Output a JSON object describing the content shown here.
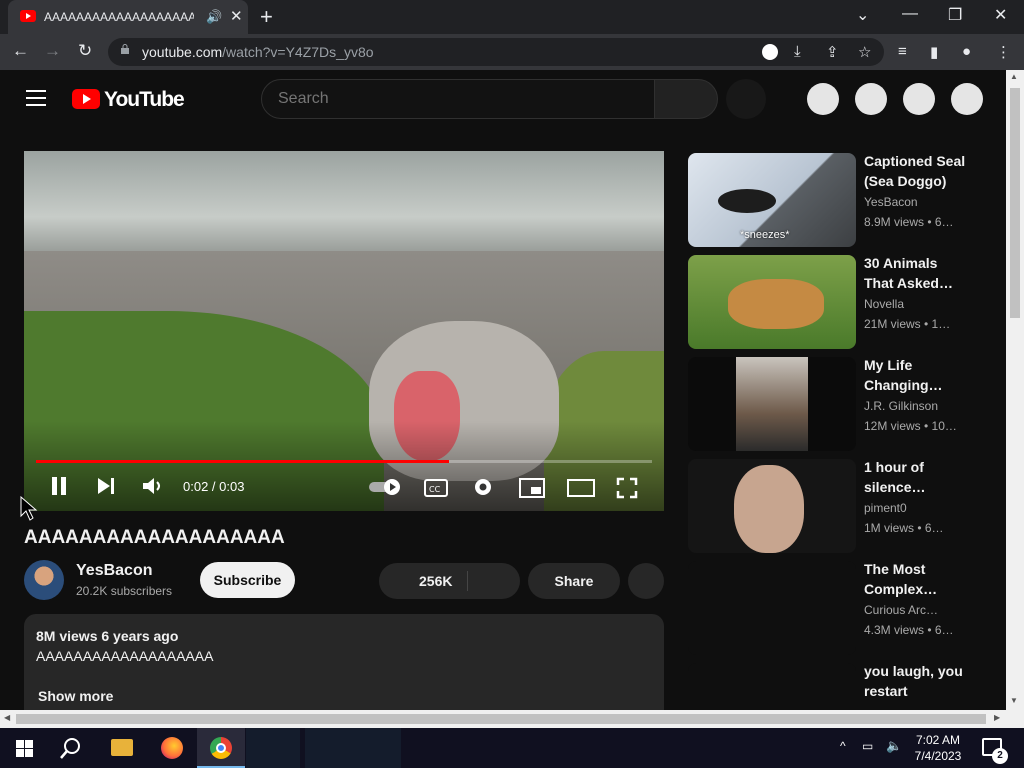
{
  "browser": {
    "tab_title": "AAAAAAAAAAAAAAAAAAAA",
    "url_host": "youtube.com",
    "url_path": "/watch?v=Y4Z7Ds_yv8o"
  },
  "youtube": {
    "logo_text": "YouTube",
    "search_placeholder": "Search",
    "video": {
      "title": "AAAAAAAAAAAAAAAAAAA",
      "time_display": "0:02 / 0:03",
      "progress": 0.67,
      "channel": "YesBacon",
      "subscribers": "20.2K subscribers",
      "subscribe_label": "Subscribe",
      "likes": "256K",
      "share_label": "Share",
      "description_meta": "8M views  6 years ago",
      "description_text": "AAAAAAAAAAAAAAAAAAA",
      "show_more": "Show more"
    },
    "recommendations": [
      {
        "title": "Captioned Seal (Sea Doggo)",
        "channel": "YesBacon",
        "meta": "8.9M views  • 6…",
        "thumb_caption": "*sneezes*"
      },
      {
        "title": "30 Animals That Asked…",
        "channel": "Novella",
        "meta": "21M views  • 1…",
        "thumb_caption": ""
      },
      {
        "title": "My Life Changing…",
        "channel": "J.R. Gilkinson",
        "meta": "12M views  • 10…",
        "thumb_caption": ""
      },
      {
        "title": "1 hour of silence…",
        "channel": "piment0",
        "meta": "1M views  • 6…",
        "thumb_caption": ""
      },
      {
        "title": "The Most Complex…",
        "channel": "Curious Arc…",
        "meta": "4.3M views  • 6…",
        "thumb_caption": ""
      },
      {
        "title": "you laugh, you restart",
        "channel": "",
        "meta": "",
        "thumb_caption": ""
      }
    ]
  },
  "taskbar": {
    "time": "7:02 AM",
    "date": "7/4/2023",
    "notification_count": "2"
  },
  "colors": {
    "yt_red": "#ff0000",
    "page_bg": "#0f0f0f",
    "chrome_bg": "#202124"
  }
}
